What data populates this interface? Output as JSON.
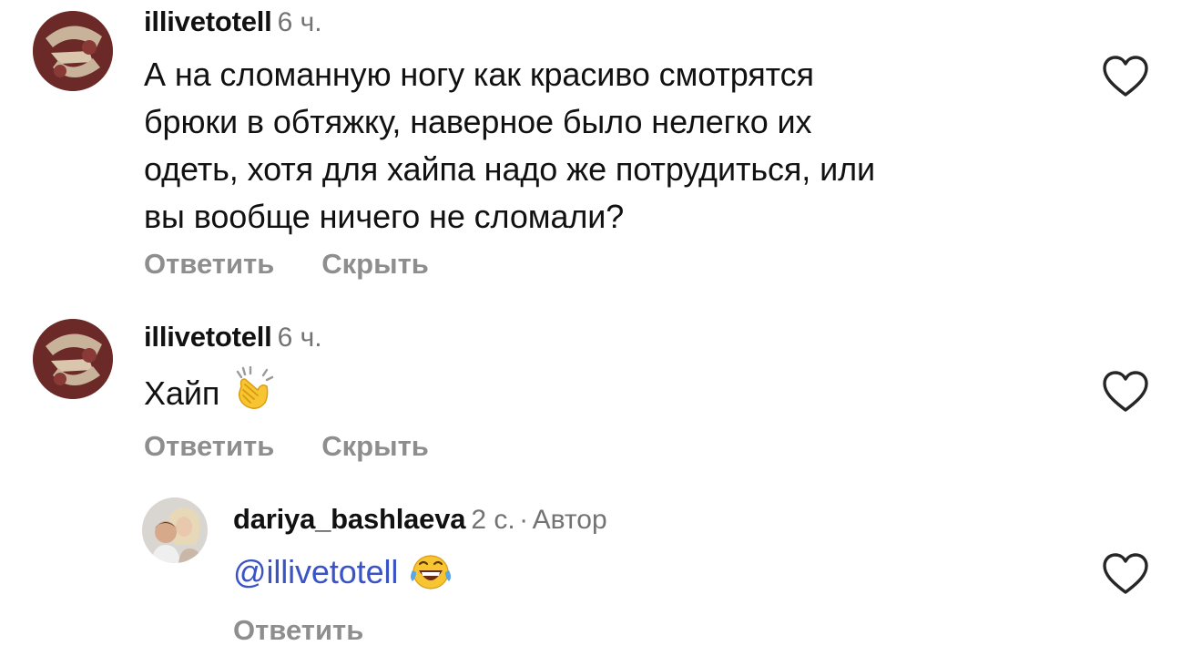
{
  "comments": [
    {
      "username": "illivetotell",
      "time": "6 ч.",
      "text_lines": [
        "А на сломанную ногу как красиво смотрятся",
        "брюки в обтяжку, наверное было нелегко их",
        "одеть, хотя для хайпа надо же потрудиться, или",
        "вы вообще ничего не сломали?"
      ],
      "reply_label": "Ответить",
      "hide_label": "Скрыть",
      "like_icon": "heart-outline-icon"
    },
    {
      "username": "illivetotell",
      "time": "6 ч.",
      "text": "Хайп",
      "emoji": "clapping-hands-emoji",
      "reply_label": "Ответить",
      "hide_label": "Скрыть",
      "like_icon": "heart-outline-icon"
    },
    {
      "username": "dariya_bashlaeva",
      "time": "2 с.",
      "separator": "·",
      "author_badge": "Автор",
      "mention": "@illivetotell",
      "emoji": "tears-of-joy-emoji",
      "reply_label": "Ответить",
      "like_icon": "heart-outline-icon"
    }
  ],
  "colors": {
    "text": "#111111",
    "secondary": "#737373",
    "action": "#8e8e8e",
    "mention": "#3a53c5",
    "icon": "#262626"
  }
}
